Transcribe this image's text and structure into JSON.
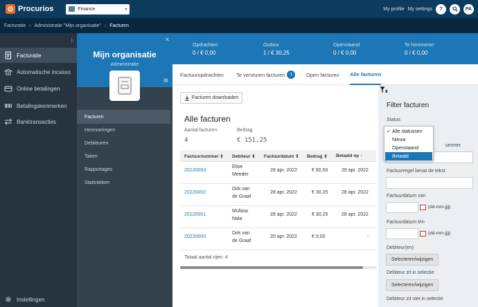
{
  "topbar": {
    "brand": "Procurios",
    "org_select": "Finance",
    "links": [
      "My profile",
      "My settings"
    ],
    "buttons": [
      "?",
      "",
      "PA"
    ]
  },
  "breadcrumb": [
    "Facturatie",
    "Administratie \"Mijn organisatie\"",
    "Facturen"
  ],
  "sidebar": {
    "items": [
      {
        "label": "Facturatie",
        "icon": "invoice-icon",
        "active": true
      },
      {
        "label": "Automatische incasso",
        "icon": "bank-icon",
        "active": false
      },
      {
        "label": "Online betalingen",
        "icon": "card-icon",
        "active": false
      },
      {
        "label": "Betalingskenmerken",
        "icon": "barcode-icon",
        "active": false
      },
      {
        "label": "Banktransacties",
        "icon": "transfer-icon",
        "active": false
      }
    ],
    "settings": "Instellingen"
  },
  "org": {
    "name": "Mijn organisatie",
    "subtitle": "Administratie",
    "menu": [
      {
        "label": "Facturen",
        "active": true
      },
      {
        "label": "Herinneringen",
        "active": false
      },
      {
        "label": "Debiteuren",
        "active": false
      },
      {
        "label": "Taken",
        "active": false
      },
      {
        "label": "Rapportages",
        "active": false
      },
      {
        "label": "Statistieken",
        "active": false
      }
    ]
  },
  "stats": [
    {
      "title": "Opdrachten",
      "value": "0 / € 0,00"
    },
    {
      "title": "Outbox",
      "value": "1 / € 30,25"
    },
    {
      "title": "Openstaand",
      "value": "0 / € 0,00"
    },
    {
      "title": "Te herinneren",
      "value": "0 / € 0,00"
    }
  ],
  "tabs": [
    {
      "label": "Factuuropdrachten",
      "active": false
    },
    {
      "label": "Te versturen facturen",
      "badge": "1",
      "active": false
    },
    {
      "label": "Open facturen",
      "active": false
    },
    {
      "label": "Alle facturen",
      "active": true
    }
  ],
  "main": {
    "download_label": "Facturen downloaden",
    "title": "Alle facturen",
    "count_label": "Aantal facturen",
    "count_value": "4",
    "amount_label": "Bedrag",
    "amount_value": "€ 151,25",
    "total_rows": "Totaal aantal rijen: 4"
  },
  "table": {
    "columns": [
      "Factuurnummer ⇕",
      "Debiteur ⇕",
      "Factuurdatum ⇕",
      "Bedrag ⇕",
      "Betaald op ↑"
    ],
    "rows": [
      {
        "nummer": "20220003",
        "debiteur": [
          "Elise",
          "Meeder"
        ],
        "datum": "29 apr. 2022",
        "bedrag": "€ 60,50",
        "betaald": "29 apr. 2022"
      },
      {
        "nummer": "20220002",
        "debiteur": [
          "Dirk van",
          "de Graaf"
        ],
        "datum": "28 apr. 2022",
        "bedrag": "€ 30,25",
        "betaald": "28 apr. 2022"
      },
      {
        "nummer": "20220001",
        "debiteur": [
          "Mufasa",
          "Nala"
        ],
        "datum": "28 apr. 2022",
        "bedrag": "€ 30,25",
        "betaald": "28 apr. 2022"
      },
      {
        "nummer": "20220000",
        "debiteur": [
          "Dirk van",
          "de Graaf"
        ],
        "datum": "20 apr. 2022",
        "bedrag": "€ 0,00",
        "betaald": "-"
      }
    ]
  },
  "filter": {
    "title": "Filter facturen",
    "status_label": "Status",
    "status_options": [
      "Alle statussen",
      "Nieuw",
      "Openstaand",
      "Betaald"
    ],
    "status_checked": "Alle statussen",
    "status_highlighted": "Betaald",
    "partial_label": "ummer",
    "factuurregel_label": "Factuurregel bevat de tekst",
    "datum_van_label": "Factuurdatum van",
    "datum_tm_label": "Factuurdatum t/m",
    "date_hint": "(dd-mm-jjjj)",
    "debiteur_label": "Debiteur(en)",
    "select_button": "Selecteren/wijzigen",
    "in_selectie_label": "Debiteur zit in selectie",
    "niet_in_selectie_label": "Debiteur zit niet in selectie"
  }
}
